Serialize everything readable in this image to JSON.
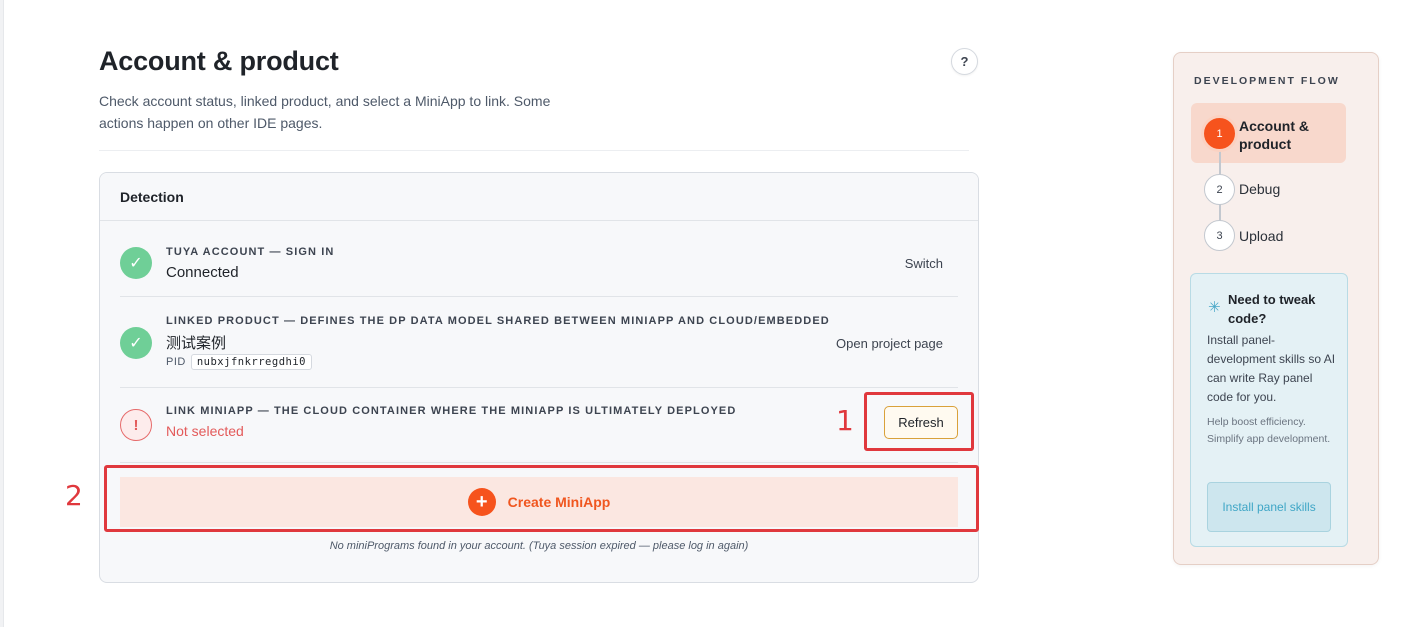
{
  "header": {
    "title": "Account & product",
    "description": "Check account status, linked product, and select a MiniApp to link. Some actions happen on other IDE pages.",
    "help_label": "?"
  },
  "detection": {
    "title": "Detection",
    "rows": [
      {
        "label": "TUYA ACCOUNT — SIGN IN",
        "value": "Connected",
        "status": "ok",
        "action": "Switch"
      },
      {
        "label": "LINKED PRODUCT — DEFINES THE DP DATA MODEL SHARED BETWEEN MINIAPP AND CLOUD/EMBEDDED",
        "value": "测试案例",
        "status": "ok",
        "pid_label": "PID",
        "pid": "nubxjfnkrregdhi0",
        "action": "Open project page"
      },
      {
        "label": "LINK MINIAPP — THE CLOUD CONTAINER WHERE THE MINIAPP IS ULTIMATELY DEPLOYED",
        "value": "Not selected",
        "status": "error",
        "action": "Refresh"
      }
    ],
    "create_label": "Create MiniApp",
    "note": "No miniPrograms found in your account. (Tuya session expired — please log in again)"
  },
  "annotations": [
    {
      "label": "1",
      "color": "#e0383d"
    },
    {
      "label": "2",
      "color": "#e0383d"
    }
  ],
  "flow": {
    "title": "DEVELOPMENT FLOW",
    "steps": [
      {
        "num": "1",
        "label": "Account & product",
        "active": true
      },
      {
        "num": "2",
        "label": "Debug",
        "active": false
      },
      {
        "num": "3",
        "label": "Upload",
        "active": false
      }
    ],
    "tip": {
      "icon": "sparkle-icon",
      "title": "Need to tweak code?",
      "body": "Install panel-development skills so AI can write Ray panel code for you.",
      "sub": "Help boost efficiency. Simplify app development.",
      "button": "Install panel skills"
    }
  },
  "colors": {
    "accent": "#f6531d",
    "success": "#6fcf97",
    "error": "#e35a5a",
    "annotation": "#e0383d"
  }
}
